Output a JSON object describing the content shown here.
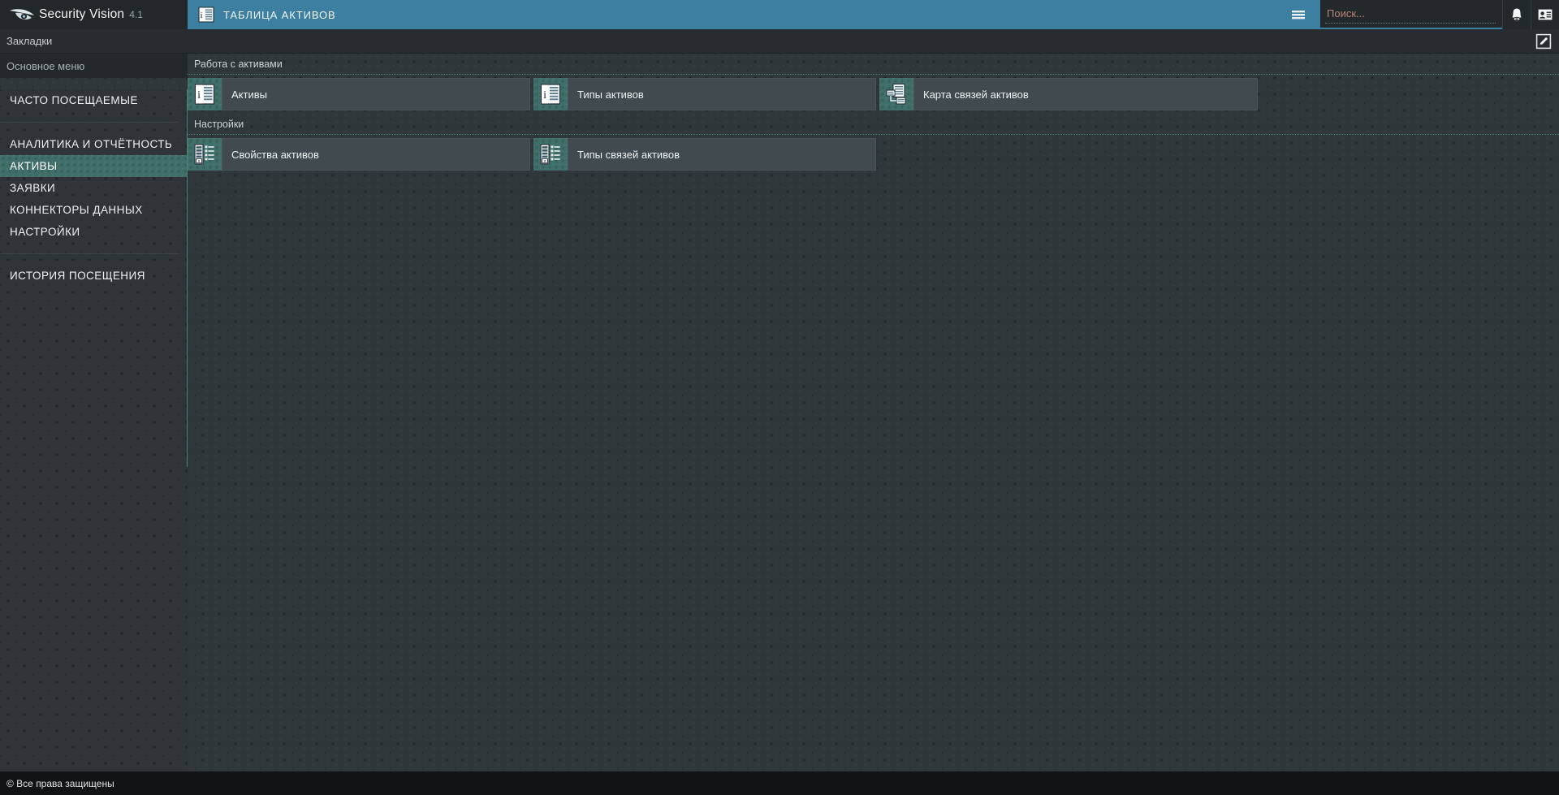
{
  "header": {
    "brand_name": "Security Vision",
    "brand_version": "4.1",
    "logo_icon": "eye-logo-icon",
    "tab": {
      "label": "ТАБЛИЦА АКТИВОВ",
      "icon": "asset-table-icon",
      "menu_icon": "hamburger-menu-icon"
    },
    "search": {
      "placeholder": "Поиск...",
      "value": "",
      "icon": "search-field"
    },
    "notifications_icon": "bell-icon",
    "profile_icon": "user-card-icon",
    "accent_color": "#3d7fa0",
    "background_color": "#23282b"
  },
  "bookmarks": {
    "label": "Закладки",
    "edit_icon": "edit-pencil-icon"
  },
  "sidebar": {
    "title": "Основное меню",
    "groups": [
      {
        "items": [
          {
            "label": "ЧАСТО ПОСЕЩАЕМЫЕ",
            "name": "sidebar-item-frequent",
            "active": false
          }
        ]
      },
      {
        "items": [
          {
            "label": "АНАЛИТИКА И ОТЧЁТНОСТЬ",
            "name": "sidebar-item-analytics",
            "active": false
          },
          {
            "label": "АКТИВЫ",
            "name": "sidebar-item-assets",
            "active": true
          },
          {
            "label": "ЗАЯВКИ",
            "name": "sidebar-item-requests",
            "active": false
          },
          {
            "label": "КОННЕКТОРЫ ДАННЫХ",
            "name": "sidebar-item-connectors",
            "active": false
          },
          {
            "label": "НАСТРОЙКИ",
            "name": "sidebar-item-settings",
            "active": false
          }
        ]
      },
      {
        "items": [
          {
            "label": "ИСТОРИЯ ПОСЕЩЕНИЯ",
            "name": "sidebar-item-history",
            "active": false
          }
        ]
      }
    ],
    "active_color": "#3f6f68"
  },
  "main": {
    "sections": [
      {
        "title": "Работа с активами",
        "name": "section-asset-work",
        "tiles": [
          {
            "label": "Активы",
            "name": "tile-assets",
            "icon": "asset-book-icon",
            "width_class": "w-assets"
          },
          {
            "label": "Типы активов",
            "name": "tile-asset-types",
            "icon": "asset-book-icon",
            "width_class": "w-asset-types"
          },
          {
            "label": "Карта связей активов",
            "name": "tile-asset-relation-map",
            "icon": "relation-map-icon",
            "width_class": "w-asset-map"
          }
        ]
      },
      {
        "title": "Настройки",
        "name": "section-settings",
        "tiles": [
          {
            "label": "Свойства активов",
            "name": "tile-asset-properties",
            "icon": "properties-list-icon",
            "width_class": "w-asset-props"
          },
          {
            "label": "Типы связей активов",
            "name": "tile-asset-relation-types",
            "icon": "properties-list-icon",
            "width_class": "w-rel-types"
          }
        ]
      }
    ]
  },
  "footer": {
    "copyright": "© Все права защищены"
  }
}
